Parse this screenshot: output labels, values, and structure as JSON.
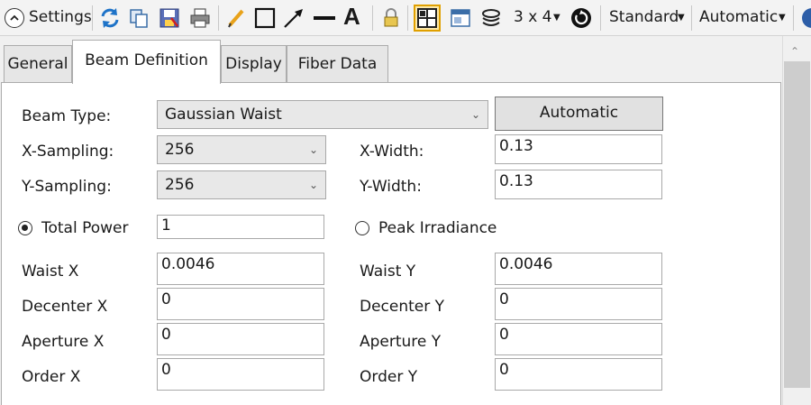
{
  "toolbar": {
    "settings_label": "Settings",
    "layout_label": "3 x 4",
    "standard_label": "Standard",
    "automatic_label": "Automatic",
    "icons": [
      "chevron-up-icon",
      "refresh-icon",
      "copy-icon",
      "save-icon",
      "print-icon",
      "pencil-icon",
      "rectangle-icon",
      "arrow-icon",
      "line-icon",
      "text-icon",
      "lock-icon",
      "layout-grid-icon",
      "window-icon",
      "layers-icon",
      "rotate-icon"
    ],
    "accent": "#e0a000"
  },
  "tabs": [
    {
      "label": "General",
      "active": false
    },
    {
      "label": "Beam Definition",
      "active": true
    },
    {
      "label": "Display",
      "active": false
    },
    {
      "label": "Fiber Data",
      "active": false
    }
  ],
  "beam": {
    "beam_type_label": "Beam Type:",
    "beam_type_value": "Gaussian Waist",
    "automatic_button": "Automatic",
    "x_sampling_label": "X-Sampling:",
    "x_sampling_value": "256",
    "y_sampling_label": "Y-Sampling:",
    "y_sampling_value": "256",
    "x_width_label": "X-Width:",
    "x_width_value": "0.13",
    "y_width_label": "Y-Width:",
    "y_width_value": "0.13",
    "total_power_label": "Total Power",
    "total_power_value": "1",
    "total_power_selected": true,
    "peak_irradiance_label": "Peak Irradiance",
    "peak_irradiance_selected": false,
    "waist_x_label": "Waist X",
    "waist_x_value": "0.0046",
    "waist_y_label": "Waist Y",
    "waist_y_value": "0.0046",
    "decenter_x_label": "Decenter X",
    "decenter_x_value": "0",
    "decenter_y_label": "Decenter Y",
    "decenter_y_value": "0",
    "aperture_x_label": "Aperture X",
    "aperture_x_value": "0",
    "aperture_y_label": "Aperture Y",
    "aperture_y_value": "0",
    "order_x_label": "Order X",
    "order_x_value": "0",
    "order_y_label": "Order Y",
    "order_y_value": "0"
  }
}
